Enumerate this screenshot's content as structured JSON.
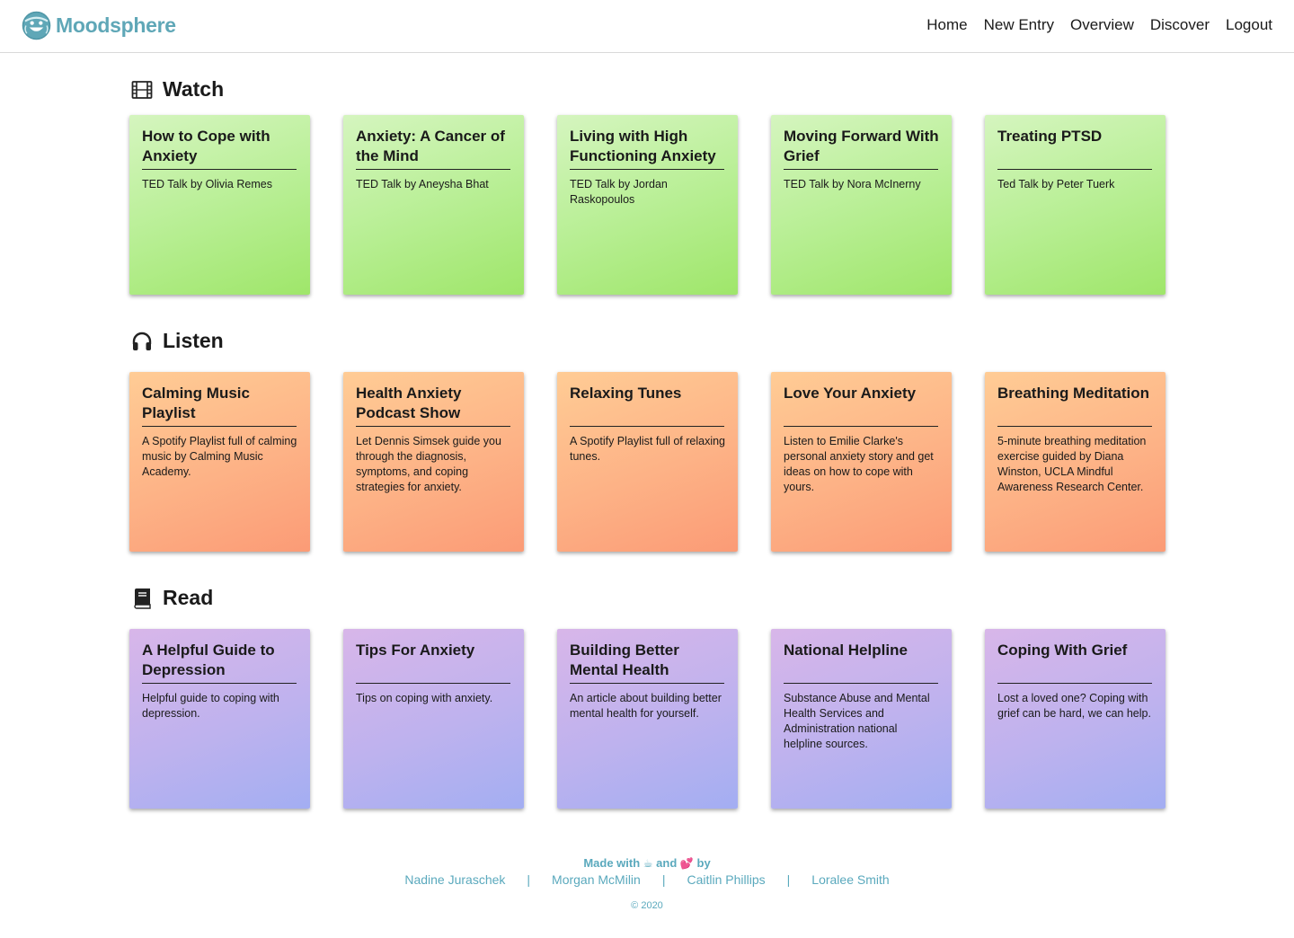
{
  "app": {
    "brand": "Moodsphere",
    "brand_color": "#5fa7b7"
  },
  "nav": {
    "home": "Home",
    "new_entry": "New Entry",
    "overview": "Overview",
    "discover": "Discover",
    "logout": "Logout"
  },
  "sections": {
    "watch": {
      "title": "Watch",
      "icon": "film-icon",
      "cards": [
        {
          "title": "How to Cope with Anxiety",
          "desc": "TED Talk by Olivia Remes"
        },
        {
          "title": "Anxiety: A Cancer of the Mind",
          "desc": "TED Talk by Aneysha Bhat"
        },
        {
          "title": "Living with High Functioning Anxiety",
          "desc": "TED Talk by Jordan Raskopoulos"
        },
        {
          "title": "Moving Forward With Grief",
          "desc": "TED Talk by Nora McInerny"
        },
        {
          "title": "Treating PTSD",
          "desc": "Ted Talk by Peter Tuerk"
        }
      ]
    },
    "listen": {
      "title": "Listen",
      "icon": "headphones-icon",
      "cards": [
        {
          "title": "Calming Music Playlist",
          "desc": "A Spotify Playlist full of calming music by Calming Music Academy."
        },
        {
          "title": "Health Anxiety Podcast Show",
          "desc": "Let Dennis Simsek guide you through the diagnosis, symptoms, and coping strategies for anxiety."
        },
        {
          "title": "Relaxing Tunes",
          "desc": "A Spotify Playlist full of relaxing tunes."
        },
        {
          "title": "Love Your Anxiety",
          "desc": "Listen to Emilie Clarke's personal anxiety story and get ideas on how to cope with yours."
        },
        {
          "title": "Breathing Meditation",
          "desc": "5-minute breathing meditation exercise guided by Diana Winston, UCLA Mindful Awareness Research Center."
        }
      ]
    },
    "read": {
      "title": "Read",
      "icon": "book-icon",
      "cards": [
        {
          "title": "A Helpful Guide to Depression",
          "desc": "Helpful guide to coping with depression."
        },
        {
          "title": "Tips For Anxiety",
          "desc": "Tips on coping with anxiety."
        },
        {
          "title": "Building Better Mental Health",
          "desc": "An article about building better mental health for yourself."
        },
        {
          "title": "National Helpline",
          "desc": "Substance Abuse and Mental Health Services and Administration national helpline sources."
        },
        {
          "title": "Coping With Grief",
          "desc": "Lost a loved one? Coping with grief can be hard, we can help."
        }
      ]
    }
  },
  "footer": {
    "made_with": "Made with",
    "emoji_1": "☕",
    "and": "and",
    "emoji_2": "💕",
    "by": "by",
    "authors": [
      "Nadine Juraschek",
      "Morgan McMilin",
      "Caitlin Phillips",
      "Loralee Smith"
    ],
    "separator": "|",
    "copyright": "© 2020",
    "color": "#5aa9bd"
  }
}
